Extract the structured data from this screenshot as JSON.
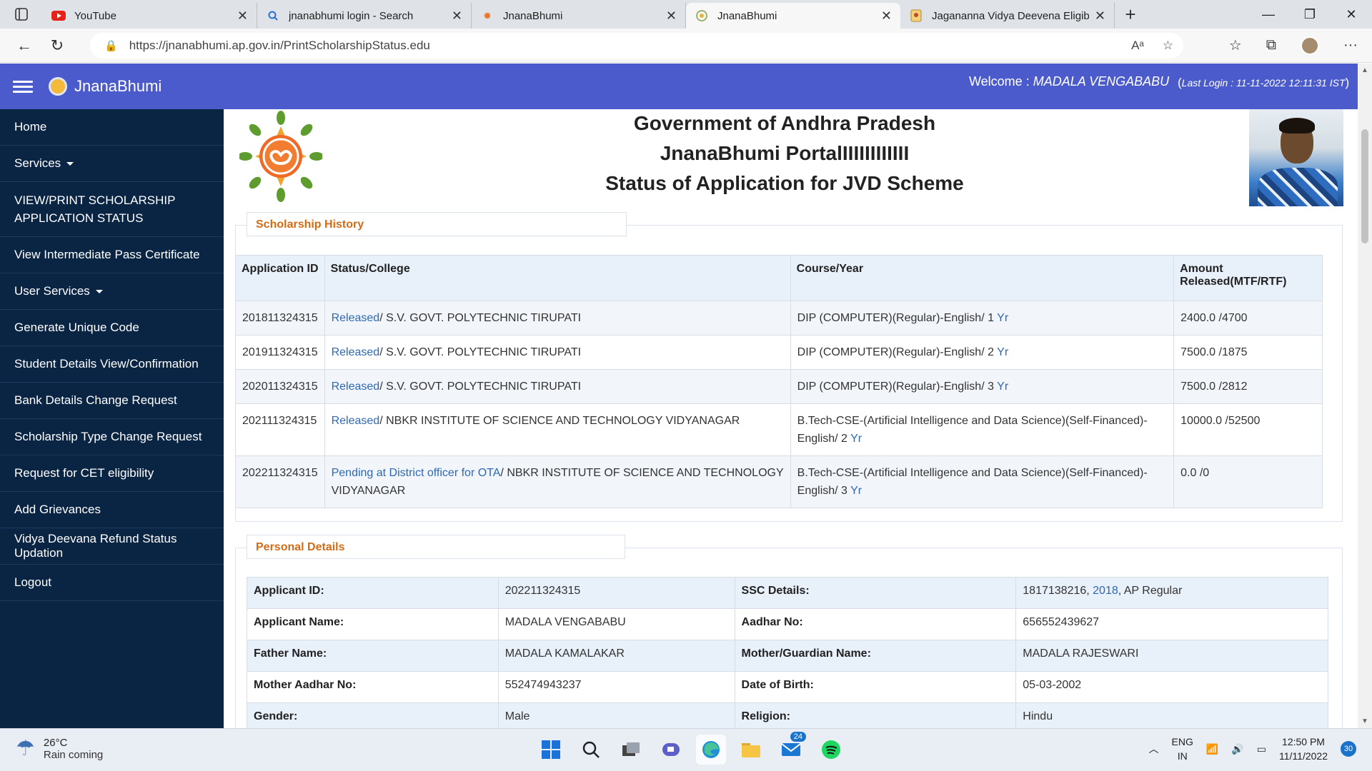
{
  "browser": {
    "tabs": [
      {
        "title": "YouTube",
        "icon": "youtube-icon"
      },
      {
        "title": "jnanabhumi login - Search",
        "icon": "search-icon"
      },
      {
        "title": "JnanaBhumi",
        "icon": "sun-icon"
      },
      {
        "title": "JnanaBhumi",
        "icon": "emblem-icon",
        "active": true
      },
      {
        "title": "Jagananna Vidya Deevena Eligibl",
        "icon": "document-icon"
      }
    ],
    "url": "https://jnanabhumi.ap.gov.in/PrintScholarshipStatus.edu"
  },
  "header": {
    "site_name": "JnanaBhumi",
    "welcome_label": "Welcome :",
    "user_name": "MADALA VENGABABU",
    "last_login_open": "(",
    "last_login": "Last Login : 11-11-2022 12:11:31 IST",
    "last_login_close": ")"
  },
  "sidebar": {
    "items": [
      {
        "label": "Home"
      },
      {
        "label": "Services",
        "dropdown": true
      },
      {
        "label": "VIEW/PRINT SCHOLARSHIP APPLICATION STATUS"
      },
      {
        "label": "View Intermediate Pass Certificate"
      },
      {
        "label": "User Services",
        "dropdown": true
      },
      {
        "label": "Generate Unique Code"
      },
      {
        "label": "Student Details View/Confirmation"
      },
      {
        "label": "Bank Details Change Request"
      },
      {
        "label": "Scholarship Type Change Request"
      },
      {
        "label": "Request for CET eligibility"
      },
      {
        "label": "Add Grievances"
      },
      {
        "label": "Vidya Deevana Refund Status Updation"
      },
      {
        "label": "Logout"
      }
    ]
  },
  "page": {
    "title_lines": [
      "Government of Andhra Pradesh",
      "JnanaBhumi PortalIIIIIIIIIIII",
      "Status of Application for JVD Scheme"
    ]
  },
  "scholarship_history": {
    "section_title": "Scholarship History",
    "columns": [
      "Application ID",
      "Status/College",
      "Course/Year",
      "Amount Released(MTF/RTF)"
    ],
    "rows": [
      {
        "app_id": "201811324315",
        "status": "Released",
        "college": "/ S.V. GOVT. POLYTECHNIC TIRUPATI",
        "course": "DIP (COMPUTER)(Regular)-English/ 1",
        "yr": "Yr",
        "amount": "2400.0 /4700"
      },
      {
        "app_id": "201911324315",
        "status": "Released",
        "college": "/ S.V. GOVT. POLYTECHNIC TIRUPATI",
        "course": "DIP (COMPUTER)(Regular)-English/ 2",
        "yr": "Yr",
        "amount": "7500.0 /1875"
      },
      {
        "app_id": "202011324315",
        "status": "Released",
        "college": "/ S.V. GOVT. POLYTECHNIC TIRUPATI",
        "course": "DIP (COMPUTER)(Regular)-English/ 3",
        "yr": "Yr",
        "amount": "7500.0 /2812"
      },
      {
        "app_id": "202111324315",
        "status": "Released",
        "college": "/ NBKR INSTITUTE OF SCIENCE AND TECHNOLOGY VIDYANAGAR",
        "course": "B.Tech-CSE-(Artificial Intelligence and Data Science)(Self-Financed)-English/ 2",
        "yr": "Yr",
        "amount": "10000.0 /52500"
      },
      {
        "app_id": "202211324315",
        "status": "Pending at District officer for OTA",
        "college": "/ NBKR INSTITUTE OF SCIENCE AND TECHNOLOGY VIDYANAGAR",
        "course": "B.Tech-CSE-(Artificial Intelligence and Data Science)(Self-Financed)-English/ 3",
        "yr": "Yr",
        "amount": "0.0 /0"
      }
    ]
  },
  "personal_details": {
    "section_title": "Personal Details",
    "rows": [
      {
        "l1": "Applicant ID:",
        "v1": "202211324315",
        "l2": "SSC Details:",
        "v2a": "1817138216, ",
        "v2b": "2018",
        "v2c": ", AP Regular"
      },
      {
        "l1": "Applicant Name:",
        "v1": "MADALA VENGABABU",
        "l2": "Aadhar No:",
        "v2a": "656552439627",
        "v2b": "",
        "v2c": ""
      },
      {
        "l1": "Father Name:",
        "v1": "MADALA KAMALAKAR",
        "l2": "Mother/Guardian Name:",
        "v2a": "MADALA RAJESWARI",
        "v2b": "",
        "v2c": ""
      },
      {
        "l1": "Mother Aadhar No:",
        "v1": "552474943237",
        "l2": "Date of Birth:",
        "v2a": "05-03-2002",
        "v2b": "",
        "v2c": ""
      },
      {
        "l1": "Gender:",
        "v1": "Male",
        "l2": "Religion:",
        "v2a": "Hindu",
        "v2b": "",
        "v2c": ""
      }
    ]
  },
  "taskbar": {
    "temperature": "26°C",
    "weather_text": "Rain coming",
    "mail_badge": "24",
    "lang_1": "ENG",
    "lang_2": "IN",
    "time": "12:50 PM",
    "date": "11/11/2022",
    "notifications": "30"
  }
}
